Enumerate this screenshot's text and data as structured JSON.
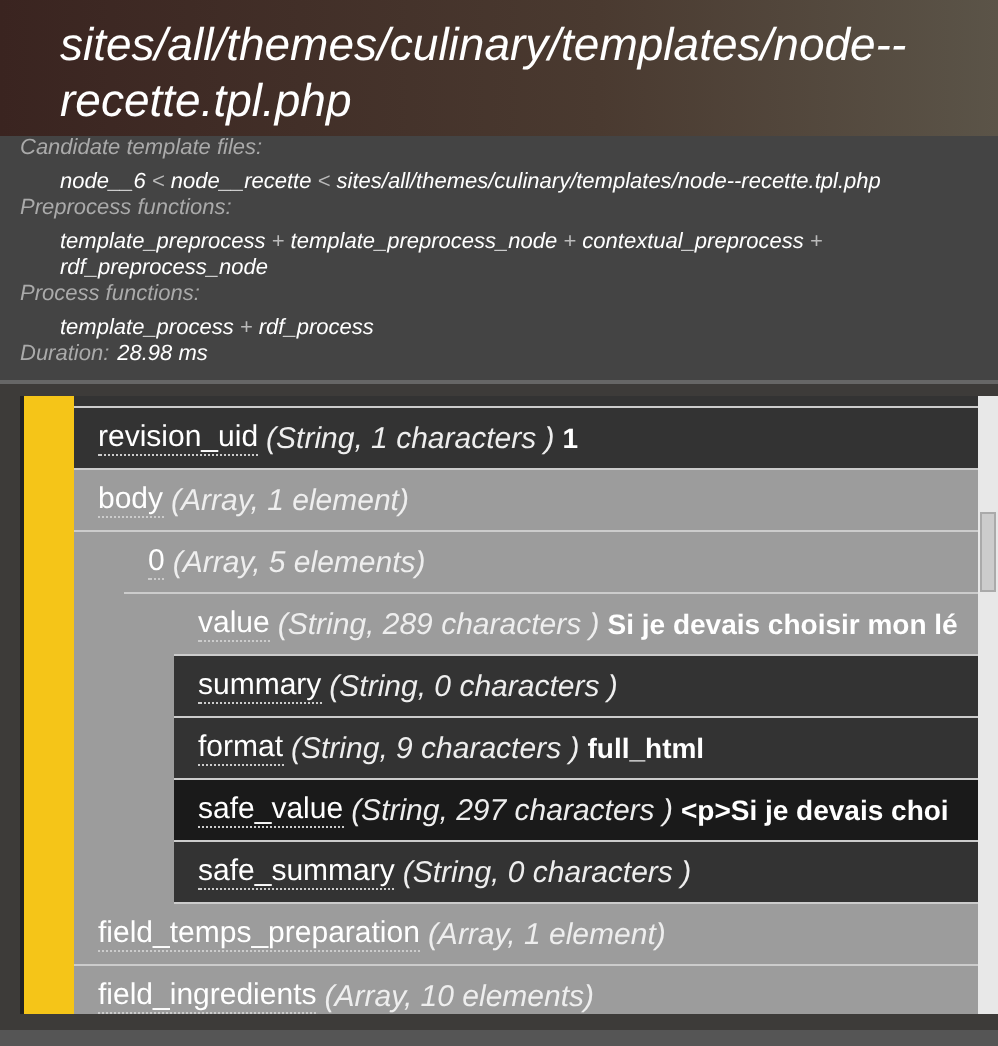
{
  "header": {
    "title": "sites/all/themes/culinary/templates/node--recette.tpl.php"
  },
  "info": [
    {
      "label": "Candidate template files:",
      "kind": "block",
      "parts": [
        "node__6",
        "<",
        "node__recette",
        "<",
        "sites/all/themes/culinary/templates/node--recette.tpl.php"
      ]
    },
    {
      "label": "Preprocess functions:",
      "kind": "block",
      "parts": [
        "template_preprocess",
        "+",
        "template_preprocess_node",
        "+",
        "contextual_preprocess",
        "+",
        "rdf_preprocess_node"
      ]
    },
    {
      "label": "Process functions:",
      "kind": "block",
      "parts": [
        "template_process",
        "+",
        "rdf_process"
      ]
    },
    {
      "label": "Duration:",
      "kind": "inline",
      "parts": [
        "28.98 ms"
      ]
    }
  ],
  "tree": [
    {
      "key": "revision_uid",
      "kind": "string",
      "type": "(String, 1 characters )",
      "value": "1",
      "selected": false
    },
    {
      "key": "body",
      "kind": "array",
      "type": "(Array, 1 element)",
      "selected": false,
      "children": [
        {
          "key": "0",
          "kind": "array",
          "type": "(Array, 5 elements)",
          "selected": false,
          "children": [
            {
              "key": "value",
              "kind": "array",
              "type": "(String, 289 characters )",
              "value": "Si je devais choisir mon lé",
              "selected": false
            },
            {
              "key": "summary",
              "kind": "string",
              "type": "(String, 0 characters )",
              "selected": false
            },
            {
              "key": "format",
              "kind": "string",
              "type": "(String, 9 characters )",
              "value": "full_html",
              "selected": false
            },
            {
              "key": "safe_value",
              "kind": "string",
              "type": "(String, 297 characters )",
              "value": "<p>Si je devais choi",
              "selected": true
            },
            {
              "key": "safe_summary",
              "kind": "string",
              "type": "(String, 0 characters )",
              "selected": false
            }
          ]
        }
      ]
    },
    {
      "key": "field_temps_preparation",
      "kind": "array",
      "type": "(Array, 1 element)",
      "selected": false
    },
    {
      "key": "field_ingredients",
      "kind": "array",
      "type": "(Array, 10 elements)",
      "selected": false
    }
  ]
}
